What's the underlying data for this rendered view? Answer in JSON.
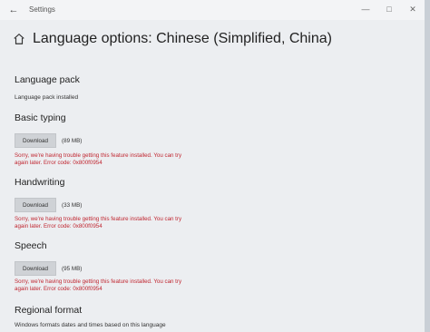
{
  "window": {
    "title": "Settings"
  },
  "header": {
    "title": "Language options: Chinese (Simplified, China)"
  },
  "sections": {
    "language_pack": {
      "heading": "Language pack",
      "status": "Language pack installed"
    },
    "basic_typing": {
      "heading": "Basic typing",
      "button_label": "Download",
      "size": "(89 MB)",
      "error_line1": "Sorry, we're having trouble getting this feature installed. You can try",
      "error_line2": "again later. Error code: 0x800f0954"
    },
    "handwriting": {
      "heading": "Handwriting",
      "button_label": "Download",
      "size": "(33 MB)",
      "error_line1": "Sorry, we're having trouble getting this feature installed. You can try",
      "error_line2": "again later. Error code: 0x800f0954"
    },
    "speech": {
      "heading": "Speech",
      "button_label": "Download",
      "size": "(95 MB)",
      "error_line1": "Sorry, we're having trouble getting this feature installed. You can try",
      "error_line2": "again later. Error code: 0x800f0954"
    },
    "regional_format": {
      "heading": "Regional format",
      "description": "Windows formats dates and times based on this language"
    }
  },
  "icons": {
    "back": "back-arrow-icon",
    "home": "home-icon"
  }
}
